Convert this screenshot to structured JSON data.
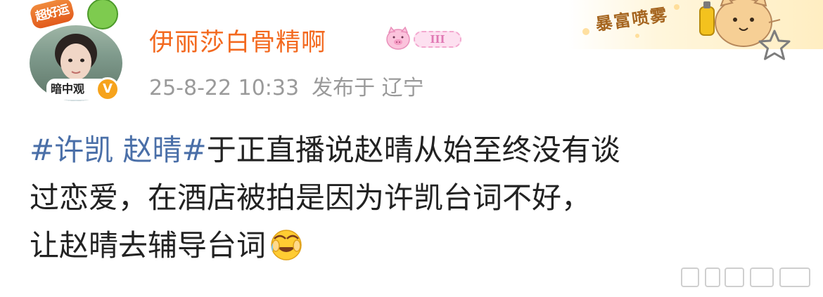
{
  "decoration": {
    "text": "暴富喷雾",
    "icon": "cat-with-spray-icon"
  },
  "favorite": {
    "icon": "star-outline-icon"
  },
  "author": {
    "avatar_pendant_text": "超好运",
    "avatar_name_tag": "暗中观",
    "verified_icon": "verified-v-icon",
    "verified_symbol": "V",
    "verified_color": "#f6a31c",
    "name": "伊丽莎白骨精啊",
    "name_color": "#f3691f",
    "level_icon": "pig-level-icon",
    "level_text": "III"
  },
  "meta": {
    "datetime": "25-8-22 10:33",
    "source": "发布于 辽宁"
  },
  "post": {
    "hashtag": "#许凯 赵晴#",
    "hashtag_color": "#4a6fa8",
    "text_line1": "于正直播说赵晴从始至终没有谈",
    "text_line2": "过恋爱，在酒店被拍是因为许凯台词不好，",
    "text_line3": "让赵晴去辅导台词",
    "emoji": "laugh-cry-cover-face-emoji"
  },
  "watermark": {
    "icon": "weibo-watermark-icon"
  }
}
